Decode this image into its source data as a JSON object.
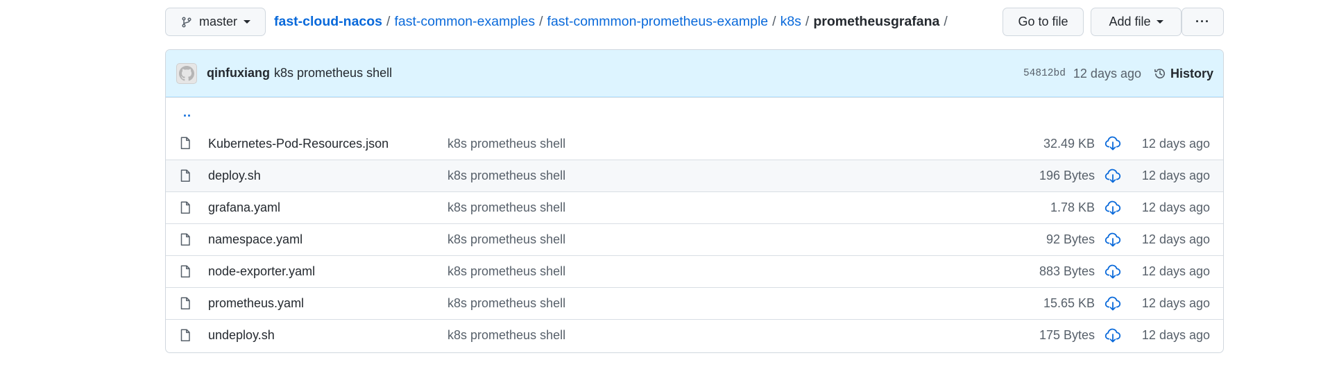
{
  "toolbar": {
    "branch": "master",
    "breadcrumb": [
      {
        "label": "fast-cloud-nacos",
        "link": true
      },
      {
        "label": "fast-common-examples",
        "link": true
      },
      {
        "label": "fast-commmon-prometheus-example",
        "link": true
      },
      {
        "label": "k8s",
        "link": true
      },
      {
        "label": "prometheusgrafana",
        "link": false
      }
    ],
    "separator": "/",
    "go_to_file": "Go to file",
    "add_file": "Add file",
    "more": "···"
  },
  "commit": {
    "author": "qinfuxiang",
    "message": "k8s prometheus shell",
    "sha": "54812bd",
    "time": "12 days ago",
    "history": "History"
  },
  "parent_dir": "..",
  "files": [
    {
      "name": "Kubernetes-Pod-Resources.json",
      "message": "k8s prometheus shell",
      "size": "32.49 KB",
      "date": "12 days ago"
    },
    {
      "name": "deploy.sh",
      "message": "k8s prometheus shell",
      "size": "196 Bytes",
      "date": "12 days ago"
    },
    {
      "name": "grafana.yaml",
      "message": "k8s prometheus shell",
      "size": "1.78 KB",
      "date": "12 days ago"
    },
    {
      "name": "namespace.yaml",
      "message": "k8s prometheus shell",
      "size": "92 Bytes",
      "date": "12 days ago"
    },
    {
      "name": "node-exporter.yaml",
      "message": "k8s prometheus shell",
      "size": "883 Bytes",
      "date": "12 days ago"
    },
    {
      "name": "prometheus.yaml",
      "message": "k8s prometheus shell",
      "size": "15.65 KB",
      "date": "12 days ago"
    },
    {
      "name": "undeploy.sh",
      "message": "k8s prometheus shell",
      "size": "175 Bytes",
      "date": "12 days ago"
    }
  ],
  "colors": {
    "link": "#0969da",
    "commit_bar": "#ddf4ff",
    "hover_row": "#f6f8fa",
    "muted_text": "#57606a"
  },
  "icons": {
    "branch": "git-branch-icon",
    "history": "history-clock-icon",
    "file": "file-icon",
    "download": "cloud-download-icon",
    "avatar": "github-octocat-avatar"
  }
}
